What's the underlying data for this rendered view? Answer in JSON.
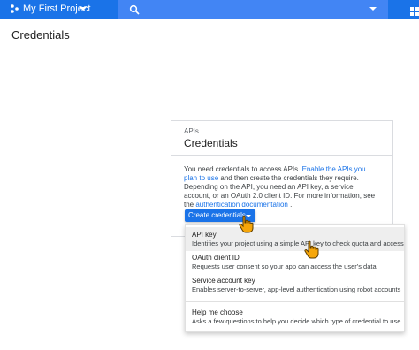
{
  "topbar": {
    "project_name": "My First Project",
    "search_placeholder": "",
    "colors": {
      "bar": "#1a73e8",
      "search": "#4285f4"
    },
    "icons": [
      "project-icon",
      "search-icon",
      "apps-grid-icon"
    ]
  },
  "page": {
    "title": "Credentials"
  },
  "card": {
    "eyebrow": "APIs",
    "title": "Credentials",
    "description": {
      "t1": "You need credentials to access APIs. ",
      "link1": "Enable the APIs you plan to use",
      "t2": " and then create the credentials they require. Depending on the API, you need an API key, a service account, or an OAuth 2.0 client ID. For more information, see the ",
      "link2": "authentication documentation",
      "t3": " ."
    },
    "create_button": "Create credentials"
  },
  "menu": {
    "items": [
      {
        "title": "API key",
        "desc": "Identifies your project using a simple API key to check quota and access"
      },
      {
        "title": "OAuth client ID",
        "desc": "Requests user consent so your app can access the user's data"
      },
      {
        "title": "Service account key",
        "desc": "Enables server-to-server, app-level authentication using robot accounts"
      },
      {
        "title": "Help me choose",
        "desc": "Asks a few questions to help you decide which type of credential to use"
      }
    ]
  },
  "colors": {
    "link": "#1a73e8",
    "button": "#1a73e8",
    "cursor": "#f6a609"
  }
}
